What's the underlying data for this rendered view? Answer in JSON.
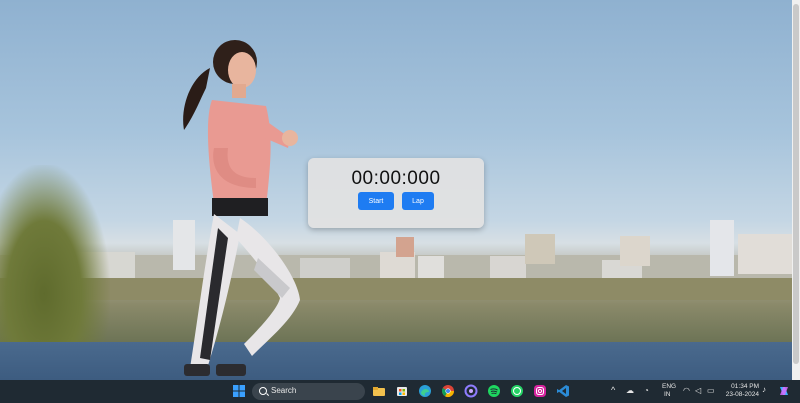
{
  "stopwatch": {
    "time": "00:00:000",
    "start_label": "Start",
    "lap_label": "Lap",
    "button_color": "#1e7cf2"
  },
  "taskbar": {
    "search_label": "Search",
    "pinned_apps": [
      "windows-start-icon",
      "file-explorer-icon",
      "store-icon",
      "edge-icon",
      "chrome-icon",
      "browser-icon",
      "spotify-icon",
      "whatsapp-icon",
      "instagram-icon",
      "vscode-icon"
    ],
    "language": "ENG",
    "region": "IN",
    "time": "01:34 PM",
    "date": "23-08-2024"
  }
}
